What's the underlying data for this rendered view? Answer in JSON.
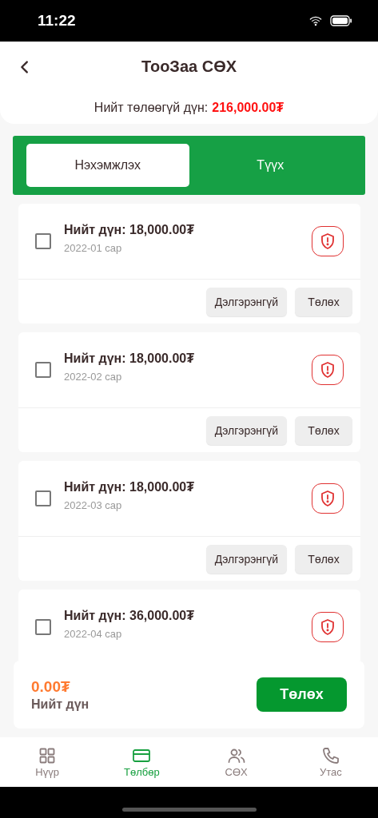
{
  "status_bar": {
    "time": "11:22"
  },
  "header": {
    "title": "ТооЗаа СӨХ"
  },
  "summary": {
    "label": "Нийт төлөөгүй дүн:",
    "amount": "216,000.00₮"
  },
  "tabs": [
    {
      "label": "Нэхэмжлэх",
      "selected": true
    },
    {
      "label": "Түүх",
      "selected": false
    }
  ],
  "invoices": [
    {
      "total": "Нийт дүн: 18,000.00₮",
      "period": "2022-01 сар",
      "checked": false,
      "buttons": [
        "Дэлгэрэнгүй",
        "Төлөх"
      ]
    },
    {
      "total": "Нийт дүн: 18,000.00₮",
      "period": "2022-02 сар",
      "checked": false,
      "buttons": [
        "Дэлгэрэнгүй",
        "Төлөх"
      ]
    },
    {
      "total": "Нийт дүн: 18,000.00₮",
      "period": "2022-03 сар",
      "checked": false,
      "buttons": [
        "Дэлгэрэнгүй",
        "Төлөх"
      ]
    },
    {
      "total": "Нийт дүн: 36,000.00₮",
      "period": "2022-04 сар",
      "checked": false
    }
  ],
  "payment_bar": {
    "amount": "0.00₮",
    "label": "Нийт дүн",
    "button": "Төлөх"
  },
  "bottom_nav": [
    {
      "label": "Нүүр",
      "kind": "grid",
      "selected": false
    },
    {
      "label": "Төлбөр",
      "kind": "card",
      "selected": true
    },
    {
      "label": "СӨХ",
      "kind": "people",
      "selected": false
    },
    {
      "label": "Утас",
      "kind": "phone",
      "selected": false
    }
  ]
}
